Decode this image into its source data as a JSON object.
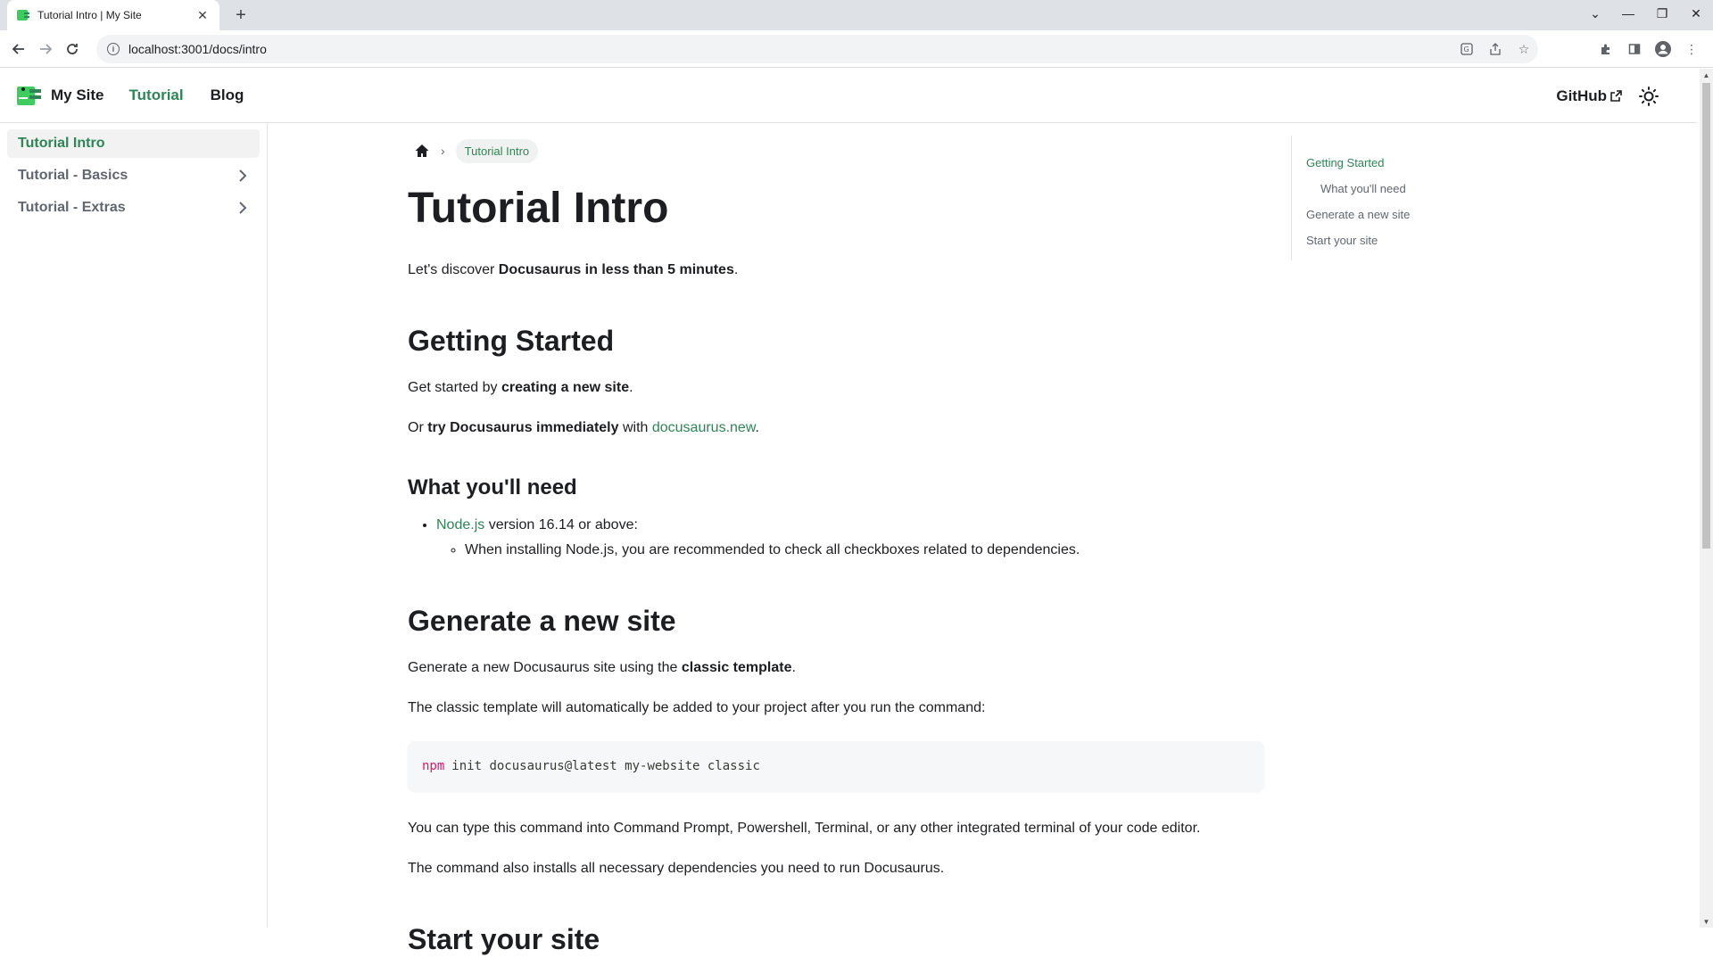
{
  "browser": {
    "tab_title": "Tutorial Intro | My Site",
    "url": "localhost:3001/docs/intro"
  },
  "navbar": {
    "brand_title": "My Site",
    "links": [
      "Tutorial",
      "Blog"
    ],
    "github_label": "GitHub"
  },
  "sidebar": {
    "items": [
      {
        "label": "Tutorial Intro",
        "active": true
      },
      {
        "label": "Tutorial - Basics",
        "expandable": true
      },
      {
        "label": "Tutorial - Extras",
        "expandable": true
      }
    ]
  },
  "breadcrumb": {
    "current": "Tutorial Intro"
  },
  "doc": {
    "title": "Tutorial Intro",
    "intro_pre": "Let's discover ",
    "intro_bold": "Docusaurus in less than 5 minutes",
    "intro_post": ".",
    "h_getting_started": "Getting Started",
    "gs_p1_pre": "Get started by ",
    "gs_p1_bold": "creating a new site",
    "gs_p1_post": ".",
    "gs_p2_pre": "Or ",
    "gs_p2_bold": "try Docusaurus immediately",
    "gs_p2_mid": " with ",
    "gs_p2_link": "docusaurus.new",
    "gs_p2_post": ".",
    "h_what_you_need": "What you'll need",
    "need_link": "Node.js",
    "need_text": " version 16.14 or above:",
    "need_sub": "When installing Node.js, you are recommended to check all checkboxes related to dependencies.",
    "h_generate": "Generate a new site",
    "gen_p1_pre": "Generate a new Docusaurus site using the ",
    "gen_p1_bold": "classic template",
    "gen_p1_post": ".",
    "gen_p2": "The classic template will automatically be added to your project after you run the command:",
    "code_cmd": "npm",
    "code_rest": "init docusaurus@latest my-website classic",
    "gen_p3": "You can type this command into Command Prompt, Powershell, Terminal, or any other integrated terminal of your code editor.",
    "gen_p4": "The command also installs all necessary dependencies you need to run Docusaurus.",
    "h_start": "Start your site"
  },
  "toc": {
    "items": [
      {
        "label": "Getting Started",
        "active": true
      },
      {
        "label": "What you'll need",
        "sub": true
      },
      {
        "label": "Generate a new site"
      },
      {
        "label": "Start your site"
      }
    ]
  },
  "colors": {
    "primary": "#2e8555",
    "code_keyword": "#e3116c"
  }
}
